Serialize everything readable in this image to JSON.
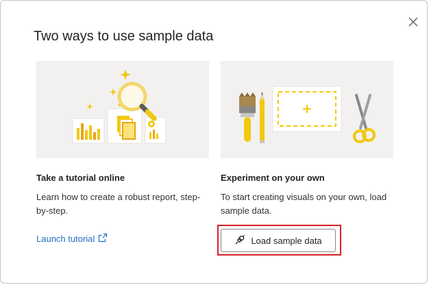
{
  "dialog": {
    "title": "Two ways to use sample data",
    "close_icon": "close-icon"
  },
  "tutorial_card": {
    "heading": "Take a tutorial online",
    "description": "Learn how to create a robust report, step-by-step.",
    "link_label": "Launch tutorial",
    "link_icon": "external-link-icon",
    "illustration": "charts-with-magnifier-illustration"
  },
  "experiment_card": {
    "heading": "Experiment on your own",
    "description": "To start creating visuals on your own, load sample data.",
    "button_label": "Load sample data",
    "button_icon": "plug-icon",
    "illustration": "brush-pencil-canvas-scissors-illustration"
  },
  "colors": {
    "accent_yellow": "#f2c811",
    "link_blue": "#1f6fc4",
    "highlight_red": "#d62229",
    "illustration_bg": "#f2f1f0"
  }
}
